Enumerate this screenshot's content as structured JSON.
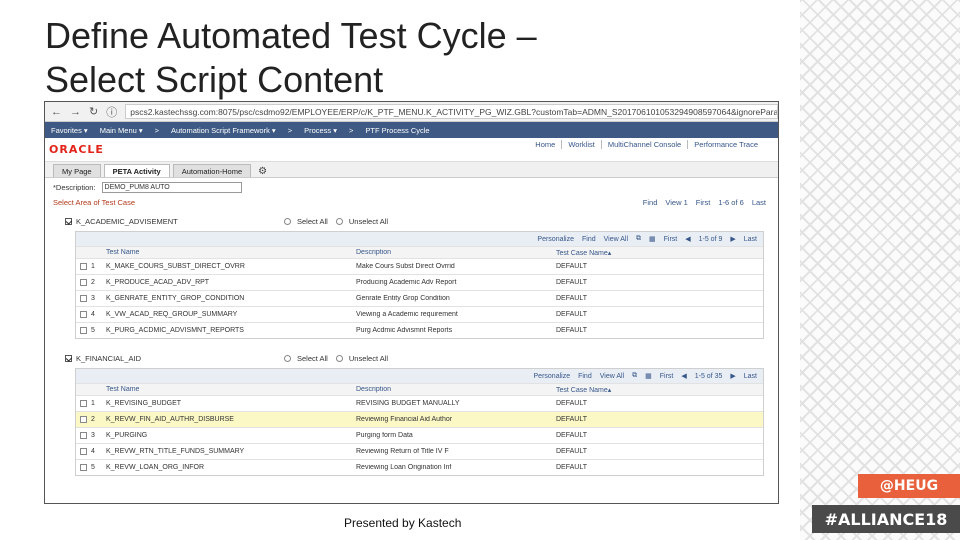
{
  "slide": {
    "title": "Define Automated Test Cycle –\nSelect Script Content",
    "footer": "Presented by Kastech",
    "tag_heug": "@HEUG",
    "tag_alliance": "#ALLIANCE18"
  },
  "browser": {
    "url": "pscs2.kastechssg.com:8075/psc/csdmo92/EMPLOYEE/ERP/c/K_PTF_MENU.K_ACTIVITY_PG_WIZ.GBL?customTab=ADMN_S201706101053294908597064&ignoreParamTemp"
  },
  "menu": [
    "Favorites ▾",
    "Main Menu ▾",
    ">",
    "Automation Script Framework ▾",
    ">",
    "Process ▾",
    ">",
    "PTF Process Cycle"
  ],
  "brand": {
    "logo": "ORACLE"
  },
  "toplinks": [
    "Home",
    "Worklist",
    "MultiChannel Console",
    "Performance Trace"
  ],
  "tabs": [
    "My Page",
    "PETA Activity",
    "Automation-Home"
  ],
  "description": {
    "label": "*Description:",
    "value": "DEMO_PUM8 AUTO"
  },
  "area": {
    "label": "Select Area of Test Case",
    "find": "Find",
    "view": "View 1",
    "first": "First",
    "range": "1-6 of 6",
    "last": "Last"
  },
  "groups": [
    {
      "name": "K_ACADEMIC_ADVISEMENT",
      "select_all": "Select All",
      "unselect_all": "Unselect All",
      "nav": {
        "personalize": "Personalize",
        "find": "Find",
        "view_all": "View All",
        "first": "First",
        "range": "1-5 of 9",
        "last": "Last"
      },
      "columns": [
        "Test Name",
        "Description",
        "Test Case Name▴"
      ],
      "rows": [
        {
          "n": "1",
          "name": "K_MAKE_COURS_SUBST_DIRECT_OVRR",
          "desc": "Make Cours Subst Direct Ovrrid",
          "case": "DEFAULT"
        },
        {
          "n": "2",
          "name": "K_PRODUCE_ACAD_ADV_RPT",
          "desc": "Producing Academic Adv Report",
          "case": "DEFAULT"
        },
        {
          "n": "3",
          "name": "K_GENRATE_ENTITY_GROP_CONDITION",
          "desc": "Genrate Entity Grop Condition",
          "case": "DEFAULT"
        },
        {
          "n": "4",
          "name": "K_VW_ACAD_REQ_GROUP_SUMMARY",
          "desc": "Viewing a Academic requirement",
          "case": "DEFAULT"
        },
        {
          "n": "5",
          "name": "K_PURG_ACDMIC_ADVISMNT_REPORTS",
          "desc": "Purg Acdmic Advismnt Reports",
          "case": "DEFAULT"
        }
      ]
    },
    {
      "name": "K_FINANCIAL_AID",
      "select_all": "Select All",
      "unselect_all": "Unselect All",
      "nav": {
        "personalize": "Personalize",
        "find": "Find",
        "view_all": "View All",
        "first": "First",
        "range": "1-5 of 35",
        "last": "Last"
      },
      "columns": [
        "Test Name",
        "Description",
        "Test Case Name▴"
      ],
      "rows": [
        {
          "n": "1",
          "name": "K_REVISING_BUDGET",
          "desc": "REVISING BUDGET MANUALLY",
          "case": "DEFAULT"
        },
        {
          "n": "2",
          "name": "K_REVW_FIN_AID_AUTHR_DISBURSE",
          "desc": "Reviewing Financial Aid Author",
          "case": "DEFAULT"
        },
        {
          "n": "3",
          "name": "K_PURGING",
          "desc": "Purging form Data",
          "case": "DEFAULT"
        },
        {
          "n": "4",
          "name": "K_REVW_RTN_TITLE_FUNDS_SUMMARY",
          "desc": "Reviewing Return of Title IV F",
          "case": "DEFAULT"
        },
        {
          "n": "5",
          "name": "K_REVW_LOAN_ORG_INFOR",
          "desc": "Reviewing Loan Origination Inf",
          "case": "DEFAULT"
        }
      ]
    }
  ]
}
